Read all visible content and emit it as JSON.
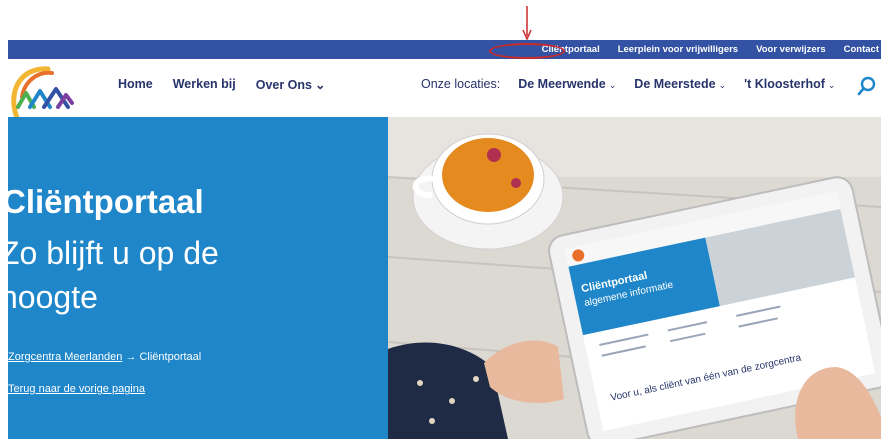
{
  "topbar": {
    "links": [
      "Cliëntportaal",
      "Leerplein voor vrijwilligers",
      "Voor verwijzers",
      "Contact"
    ]
  },
  "nav": {
    "main": [
      {
        "label": "Home",
        "chevron": ""
      },
      {
        "label": "Werken bij",
        "chevron": ""
      },
      {
        "label": "Over Ons",
        "chevron": "⌄"
      }
    ],
    "locations_label": "Onze locaties:",
    "locations": [
      {
        "label": "De Meerwende",
        "chevron": "⌄"
      },
      {
        "label": "De Meerstede",
        "chevron": "⌄"
      },
      {
        "label": "'t Kloosterhof",
        "chevron": "⌄"
      }
    ]
  },
  "hero": {
    "title": "Cliëntportaal",
    "subtitle": "Zo blijft u op de hoogte",
    "breadcrumb": {
      "home": "Zorgcentra Meerlanden",
      "separator": "→",
      "current": "Cliëntportaal"
    },
    "back_link": "Terug naar de vorige pagina"
  },
  "tablet": {
    "title": "Cliëntportaal",
    "subtitle": "algemene informatie",
    "caption": "Voor u, als cliënt van één van de zorgcentra"
  },
  "colors": {
    "topbar": "#3452a3",
    "hero": "#1e86c9",
    "nav_text": "#27346b",
    "annotation": "#c92a2a"
  }
}
